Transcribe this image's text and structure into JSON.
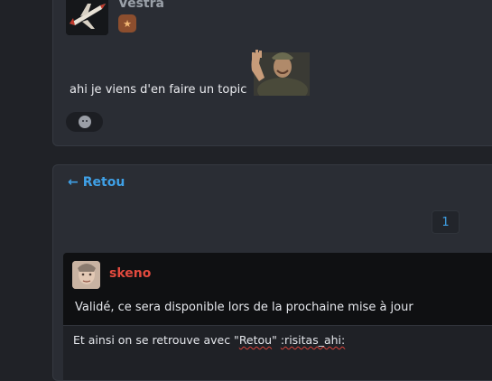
{
  "post": {
    "username": "Vestra",
    "badge_icon": "star-icon",
    "text": "ahi je viens d'en faire un topic",
    "sticker": "waving-man-sticker"
  },
  "topic": {
    "back_label": "Retou",
    "pagination": {
      "current_page": "1"
    },
    "quote": {
      "author": "skeno",
      "text": "Validé, ce sera disponible lors de la prochaine mise à jour"
    },
    "reply": {
      "before": "Et ainsi on se retrouve avec \"",
      "word": "Retou",
      "middle": "\" ",
      "sticker_code": ":risitas_ahi:"
    }
  },
  "colors": {
    "accent": "#3fa0e6",
    "author_red": "#e24a3e",
    "card_bg": "#2a2d34",
    "page_bg": "#202227"
  }
}
